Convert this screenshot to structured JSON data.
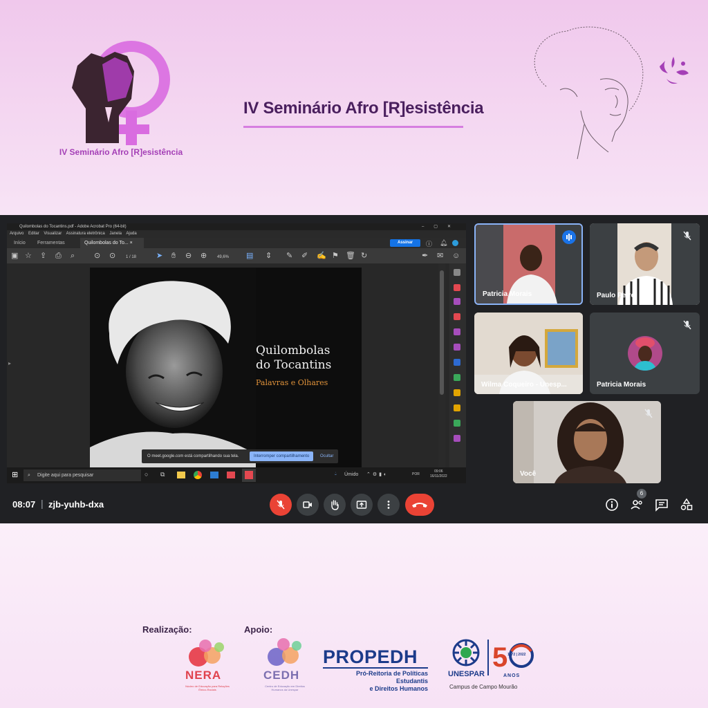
{
  "event": {
    "title": "IV Seminário Afro [R]esistência",
    "logo_caption": "IV Seminário Afro [R]esistência"
  },
  "shared_screen": {
    "window_title": "Quilombolas do Tocantins.pdf - Adobe Acrobat Pro (64-bit)",
    "menu": [
      "Arquivo",
      "Editar",
      "Visualizar",
      "Assinatura eletrônica",
      "Janela",
      "Ajuda"
    ],
    "tabs": [
      "Início",
      "Ferramentas",
      "Quilombolas do To..."
    ],
    "sign_button": "Assinar",
    "page_indicator": "1 / 18",
    "zoom": "49,6%",
    "cover": {
      "title_line1": "Quilombolas",
      "title_line2": "do Tocantins",
      "subtitle": "Palavras e Olhares"
    },
    "share_banner": {
      "text": "O meet.google.com está compartilhando sua tela.",
      "stop_button": "Interromper compartilhamento",
      "hide_button": "Ocultar"
    },
    "taskbar": {
      "search_placeholder": "Digite aqui para pesquisar",
      "weather": "Úmido",
      "language": "POR",
      "time": "09:06",
      "date": "16/11/2022"
    }
  },
  "participants": [
    {
      "name": "Patricia Morais",
      "speaking": true
    },
    {
      "name": "Paulo Petro",
      "muted": true
    },
    {
      "name": "Wilma Coqueiro - Unesp..."
    },
    {
      "name": "Patricia Morais",
      "muted": true
    },
    {
      "name": "Você",
      "muted": true
    }
  ],
  "meeting": {
    "time": "08:07",
    "separator": "|",
    "code": "zjb-yuhb-dxa",
    "people_count": "6"
  },
  "footer": {
    "realizacao_label": "Realização:",
    "apoio_label": "Apoio:",
    "nera": "NERA",
    "nera_sub": "Núcleo de Educação para Relações Étnico-Raciais",
    "cedh": "CEDH",
    "cedh_sub": "Centro de Educação em Direitos Humanos da Unespar",
    "propedh": "PROPEDH",
    "propedh_sub_line1": "Pró-Reitoria de Políticas Estudantis",
    "propedh_sub_line2": "e Direitos Humanos",
    "unespar": "UNESPAR",
    "anniversary_years": "1972 | 2022",
    "anos": "ANOS",
    "campus": "Campus de Campo Mourão"
  },
  "colors": {
    "accent_purple": "#a43fb6",
    "title_purple": "#4a1f5e",
    "meet_bg": "#202124",
    "hangup_red": "#ea4335",
    "propedh_blue": "#1c3b8a"
  }
}
